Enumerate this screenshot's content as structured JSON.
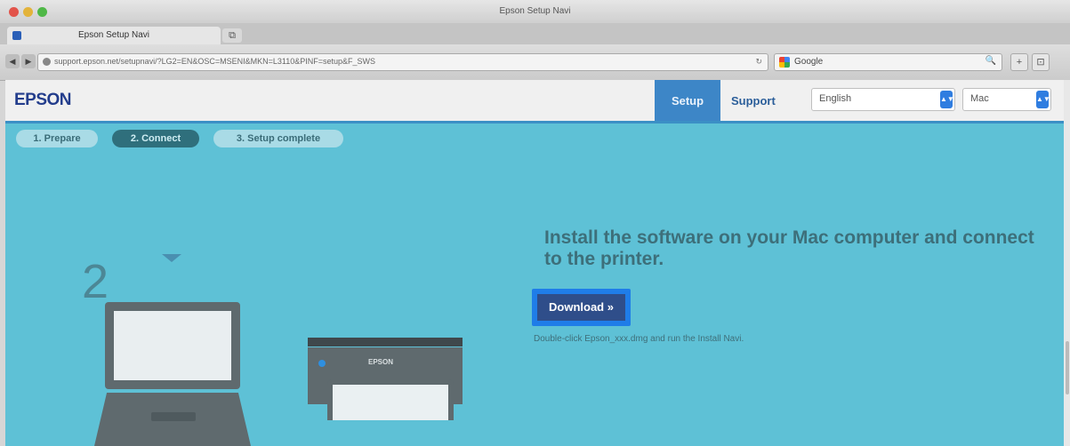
{
  "window": {
    "title": "Epson Setup Navi"
  },
  "tab": {
    "title": "Epson Setup Navi",
    "new_tab_icon": "⧉"
  },
  "toolbar": {
    "back_icon": "◀",
    "forward_icon": "▶",
    "url": "support.epson.net/setupnavi/?LG2=EN&OSC=MSENI&MKN=L3110&PINF=setup&F_SWS",
    "reload_icon": "↻",
    "search_placeholder": "Google",
    "search_icon": "🔍",
    "add_icon": "+",
    "sidebar_icon": "⊡"
  },
  "header": {
    "logo": "EPSON",
    "setup_tab": "Setup",
    "support_tab": "Support",
    "language": "English",
    "os": "Mac",
    "select_arrow": "▲▼"
  },
  "steps": [
    {
      "label": "1. Prepare",
      "active": false
    },
    {
      "label": "2. Connect",
      "active": true
    },
    {
      "label": "3. Setup complete",
      "active": false
    }
  ],
  "illustration": {
    "step_number": "2",
    "printer_brand": "EPSON"
  },
  "content": {
    "headline": "Install the software on your Mac computer and connect to the printer.",
    "download_label": "Download »",
    "hint": "Double-click Epson_xxx.dmg and run the Install Navi."
  },
  "colors": {
    "page_bg": "#5ec1d6",
    "accent": "#3d86c7",
    "download_bg": "#2f4e8a",
    "focus_ring": "#1f7de8"
  }
}
